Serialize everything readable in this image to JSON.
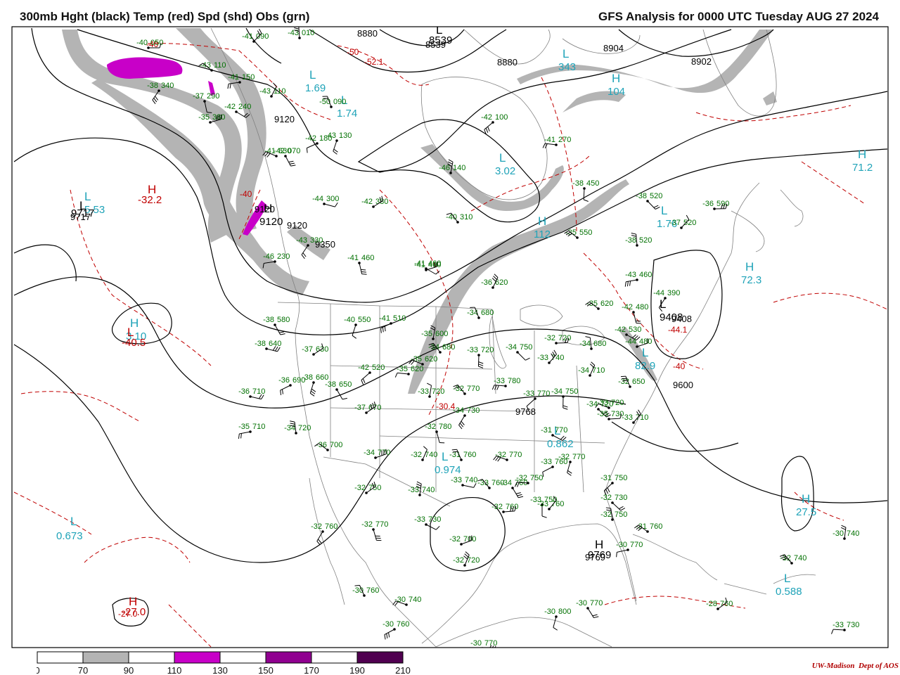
{
  "title_left": "300mb Hght (black) Temp (red) Spd (shd) Obs (grn)",
  "title_right": "GFS Analysis for 0000 UTC Tuesday  AUG 27 2024",
  "credit": {
    "org": "UW-Madison",
    "dept": "Dept of AOS"
  },
  "colors": {
    "height": "#000000",
    "temp": "#c00000",
    "obs": "#007000",
    "extrema_cyan": "#1fa3b8",
    "shade_70": "#b4b4b4",
    "shade_110": "#c800c8",
    "shade_150": "#900090",
    "shade_190": "#500050",
    "coast": "#808080"
  },
  "colorbar": {
    "ticks": [
      "0",
      "70",
      "90",
      "110",
      "130",
      "150",
      "170",
      "190",
      "210"
    ],
    "fills": [
      "#ffffff",
      "#b4b4b4",
      "#ffffff",
      "#c800c8",
      "#ffffff",
      "#900090",
      "#ffffff",
      "#500050"
    ]
  },
  "contours": {
    "height_labels": [
      "8880",
      "8539",
      "8880",
      "8904",
      "8902",
      "9120",
      "9120",
      "9120",
      "9350",
      "9717",
      "9408",
      "9600",
      "9768",
      "9769"
    ],
    "temp_labels": [
      "-40",
      "-50",
      "-52.1",
      "-40",
      "-30.4",
      "-44.1",
      "-40",
      "-27.0"
    ]
  },
  "extrema": [
    {
      "type": "L",
      "value": "8539",
      "color": "black"
    },
    {
      "type": "L",
      "value": "1.69",
      "color": "cyan"
    },
    {
      "type": "L",
      "value": "1.74",
      "color": "cyan"
    },
    {
      "type": "L",
      "value": "343",
      "color": "cyan"
    },
    {
      "type": "H",
      "value": "104",
      "color": "cyan"
    },
    {
      "type": "H",
      "value": "9120",
      "color": "black"
    },
    {
      "type": "L",
      "value": "3.02",
      "color": "cyan"
    },
    {
      "type": "H",
      "value": "112",
      "color": "cyan"
    },
    {
      "type": "H",
      "value": "71.2",
      "color": "cyan"
    },
    {
      "type": "L",
      "value": "5.53",
      "color": "cyan"
    },
    {
      "type": "L",
      "value": "9717",
      "color": "black"
    },
    {
      "type": "H",
      "value": "-32.2",
      "color": "red"
    },
    {
      "type": "L",
      "value": "1.76",
      "color": "cyan"
    },
    {
      "type": "H",
      "value": "72.3",
      "color": "cyan"
    },
    {
      "type": "L",
      "value": "9408",
      "color": "black"
    },
    {
      "type": "H",
      "value": "3.10",
      "color": "cyan"
    },
    {
      "type": "L",
      "value": "-40.5",
      "color": "red"
    },
    {
      "type": "L",
      "value": "0.862",
      "color": "cyan"
    },
    {
      "type": "L",
      "value": "0.974",
      "color": "cyan"
    },
    {
      "type": "L",
      "value": "0.673",
      "color": "cyan"
    },
    {
      "type": "H",
      "value": "27.5",
      "color": "cyan"
    },
    {
      "type": "H",
      "value": "9769",
      "color": "black"
    },
    {
      "type": "L",
      "value": "0.588",
      "color": "cyan"
    },
    {
      "type": "H",
      "value": "-27.0",
      "color": "red"
    },
    {
      "type": "L",
      "value": "82.9",
      "color": "cyan"
    }
  ],
  "observations": [
    {
      "temp": "-40",
      "hgt": "050"
    },
    {
      "temp": "-41",
      "hgt": "090"
    },
    {
      "temp": "-43",
      "hgt": "010"
    },
    {
      "temp": "-43",
      "hgt": "110"
    },
    {
      "temp": "-41",
      "hgt": "150"
    },
    {
      "temp": "-38",
      "hgt": "340"
    },
    {
      "temp": "-37",
      "hgt": "290"
    },
    {
      "temp": "-42",
      "hgt": "240"
    },
    {
      "temp": "-35",
      "hgt": "380"
    },
    {
      "temp": "-43",
      "hgt": "110"
    },
    {
      "temp": "-50",
      "hgt": "090"
    },
    {
      "temp": "-41",
      "hgt": "630"
    },
    {
      "temp": "-42",
      "hgt": "180"
    },
    {
      "temp": "-43",
      "hgt": "130"
    },
    {
      "temp": "-42",
      "hgt": "070"
    },
    {
      "temp": "-44",
      "hgt": "300"
    },
    {
      "temp": "-42",
      "hgt": "380"
    },
    {
      "temp": "-46",
      "hgt": "140"
    },
    {
      "temp": "-40",
      "hgt": "310"
    },
    {
      "temp": "-41",
      "hgt": "270"
    },
    {
      "temp": "-42",
      "hgt": "100"
    },
    {
      "temp": "-38",
      "hgt": "450"
    },
    {
      "temp": "-38",
      "hgt": "520"
    },
    {
      "temp": "-36",
      "hgt": "590"
    },
    {
      "temp": "-37",
      "hgt": "520"
    },
    {
      "temp": "-38",
      "hgt": "520"
    },
    {
      "temp": "-35",
      "hgt": "550"
    },
    {
      "temp": "-46",
      "hgt": "230"
    },
    {
      "temp": "-43",
      "hgt": "330"
    },
    {
      "temp": "-41",
      "hgt": "460"
    },
    {
      "temp": "-41",
      "hgt": "460"
    },
    {
      "temp": "-41",
      "hgt": "460"
    },
    {
      "temp": "-36",
      "hgt": "620"
    },
    {
      "temp": "-34",
      "hgt": "680"
    },
    {
      "temp": "-35",
      "hgt": "620"
    },
    {
      "temp": "-41",
      "hgt": "510"
    },
    {
      "temp": "-40",
      "hgt": "550"
    },
    {
      "temp": "-38",
      "hgt": "580"
    },
    {
      "temp": "-38",
      "hgt": "640"
    },
    {
      "temp": "-37",
      "hgt": "630"
    },
    {
      "temp": "-35",
      "hgt": "600"
    },
    {
      "temp": "-34",
      "hgt": "680"
    },
    {
      "temp": "-35",
      "hgt": "620"
    },
    {
      "temp": "-42",
      "hgt": "520"
    },
    {
      "temp": "-33",
      "hgt": "720"
    },
    {
      "temp": "-34",
      "hgt": "750"
    },
    {
      "temp": "-32",
      "hgt": "720"
    },
    {
      "temp": "-33",
      "hgt": "740"
    },
    {
      "temp": "-34",
      "hgt": "680"
    },
    {
      "temp": "-35",
      "hgt": "620"
    },
    {
      "temp": "-43",
      "hgt": "460"
    },
    {
      "temp": "-44",
      "hgt": "390"
    },
    {
      "temp": "-42",
      "hgt": "480"
    },
    {
      "temp": "-42",
      "hgt": "530"
    },
    {
      "temp": "-44",
      "hgt": "480"
    },
    {
      "temp": "-34",
      "hgt": "710"
    },
    {
      "temp": "-32",
      "hgt": "650"
    },
    {
      "temp": "-33",
      "hgt": "720"
    },
    {
      "temp": "-36",
      "hgt": "690"
    },
    {
      "temp": "-38",
      "hgt": "660"
    },
    {
      "temp": "-38",
      "hgt": "650"
    },
    {
      "temp": "-36",
      "hgt": "710"
    },
    {
      "temp": "-37",
      "hgt": "670"
    },
    {
      "temp": "-33",
      "hgt": "720"
    },
    {
      "temp": "-32",
      "hgt": "770"
    },
    {
      "temp": "-33",
      "hgt": "780"
    },
    {
      "temp": "-33",
      "hgt": "770"
    },
    {
      "temp": "-34",
      "hgt": "750"
    },
    {
      "temp": "-34",
      "hgt": "720"
    },
    {
      "temp": "-35",
      "hgt": "730"
    },
    {
      "temp": "-33",
      "hgt": "710"
    },
    {
      "temp": "-34",
      "hgt": "720"
    },
    {
      "temp": "-36",
      "hgt": "700"
    },
    {
      "temp": "-35",
      "hgt": "710"
    },
    {
      "temp": "-34",
      "hgt": "730"
    },
    {
      "temp": "-32",
      "hgt": "780"
    },
    {
      "temp": "-31",
      "hgt": "770"
    },
    {
      "temp": "-34",
      "hgt": "770"
    },
    {
      "temp": "-32",
      "hgt": "740"
    },
    {
      "temp": "-31",
      "hgt": "760"
    },
    {
      "temp": "-32",
      "hgt": "770"
    },
    {
      "temp": "-33",
      "hgt": "760"
    },
    {
      "temp": "-32",
      "hgt": "770"
    },
    {
      "temp": "-34",
      "hgt": "760"
    },
    {
      "temp": "-33",
      "hgt": "740"
    },
    {
      "temp": "-32",
      "hgt": "750"
    },
    {
      "temp": "-33",
      "hgt": "740"
    },
    {
      "temp": "-33",
      "hgt": "760"
    },
    {
      "temp": "-32",
      "hgt": "750"
    },
    {
      "temp": "-31",
      "hgt": "750"
    },
    {
      "temp": "-33",
      "hgt": "750"
    },
    {
      "temp": "-32",
      "hgt": "730"
    },
    {
      "temp": "-32",
      "hgt": "760"
    },
    {
      "temp": "-33",
      "hgt": "760"
    },
    {
      "temp": "-32",
      "hgt": "750"
    },
    {
      "temp": "-31",
      "hgt": "760"
    },
    {
      "temp": "-30",
      "hgt": "770"
    },
    {
      "temp": "-32",
      "hgt": "760"
    },
    {
      "temp": "-32",
      "hgt": "770"
    },
    {
      "temp": "-33",
      "hgt": "730"
    },
    {
      "temp": "-32",
      "hgt": "700"
    },
    {
      "temp": "-32",
      "hgt": "720"
    },
    {
      "temp": "-30",
      "hgt": "760"
    },
    {
      "temp": "-30",
      "hgt": "740"
    },
    {
      "temp": "-30",
      "hgt": "760"
    },
    {
      "temp": "-30",
      "hgt": "800"
    },
    {
      "temp": "-30",
      "hgt": "770"
    },
    {
      "temp": "-30",
      "hgt": "770"
    },
    {
      "temp": "-28",
      "hgt": "760"
    },
    {
      "temp": "-30",
      "hgt": "740"
    },
    {
      "temp": "-32",
      "hgt": "740"
    },
    {
      "temp": "-33",
      "hgt": "730"
    },
    {
      "temp": "-30",
      "hgt": "730"
    }
  ]
}
